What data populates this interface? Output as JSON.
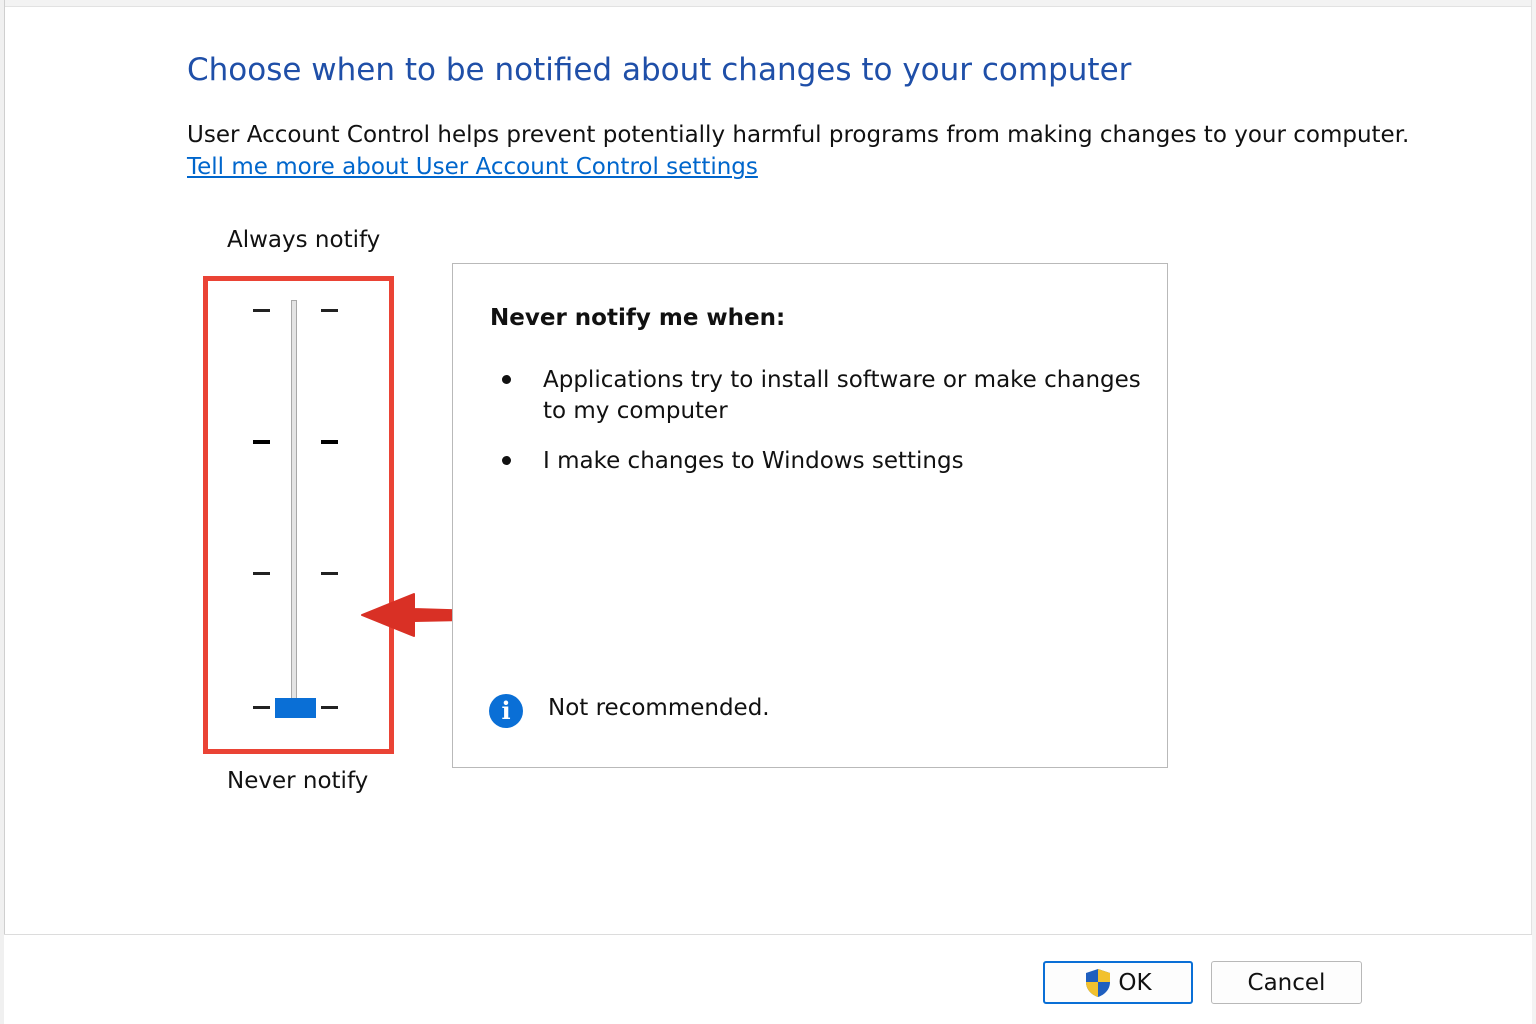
{
  "dialog": {
    "title": "Choose when to be notified about changes to your computer",
    "description": "User Account Control helps prevent potentially harmful programs from making changes to your computer.",
    "help_link": "Tell me more about User Account Control settings"
  },
  "slider": {
    "top_label": "Always notify",
    "bottom_label": "Never notify",
    "levels": 4,
    "selected_level": 1,
    "thumb_color": "#0a6fd6",
    "highlight_color": "#ea4335"
  },
  "panel": {
    "heading": "Never notify me when:",
    "bullets": [
      "Applications try to install software or make changes to my computer",
      "I make changes to Windows settings"
    ],
    "info_icon": "info-icon",
    "info_text": "Not recommended."
  },
  "buttons": {
    "ok_label": "OK",
    "ok_icon": "uac-shield-icon",
    "cancel_label": "Cancel"
  },
  "colors": {
    "title": "#1f4fa8",
    "link": "#0066cc",
    "accent": "#0a6fd6",
    "annotation": "#d93025"
  }
}
